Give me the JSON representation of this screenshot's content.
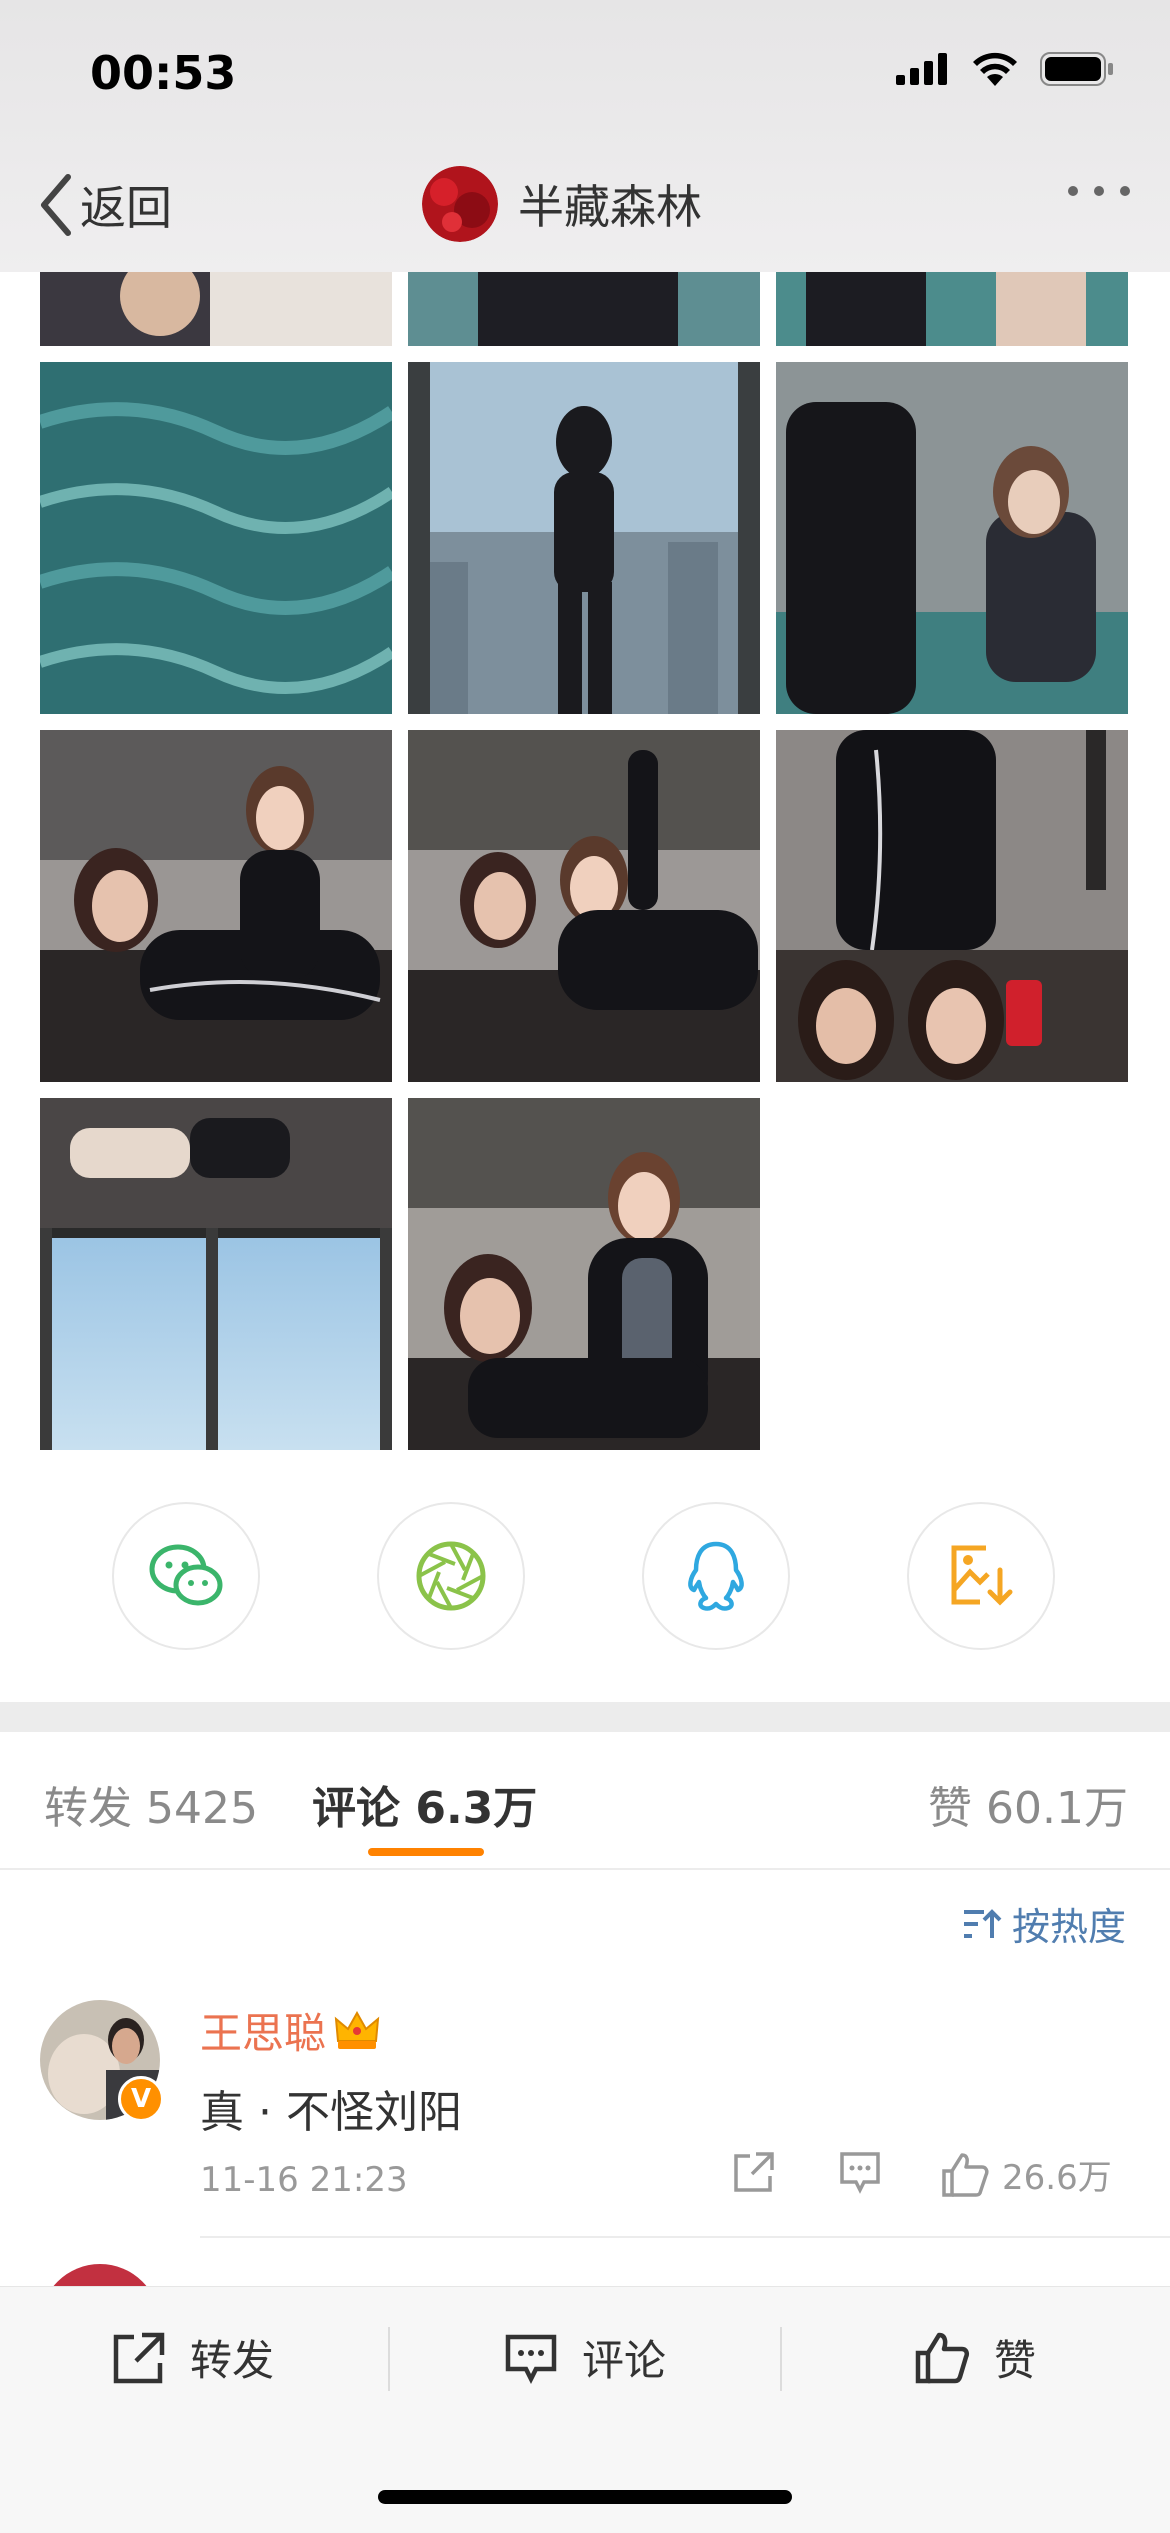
{
  "status": {
    "time": "00:53"
  },
  "nav": {
    "back_label": "返回",
    "title": "半藏森林"
  },
  "photos": [
    {
      "name": "photo-1"
    },
    {
      "name": "photo-2"
    },
    {
      "name": "photo-3"
    },
    {
      "name": "photo-4"
    },
    {
      "name": "photo-5"
    },
    {
      "name": "photo-6"
    },
    {
      "name": "photo-7"
    },
    {
      "name": "photo-8"
    },
    {
      "name": "photo-9"
    },
    {
      "name": "photo-10"
    },
    {
      "name": "photo-11"
    }
  ],
  "share": [
    "wechat-icon",
    "moments-icon",
    "qq-icon",
    "save-image-icon"
  ],
  "tabs": {
    "repost_label": "转发",
    "repost_count": "5425",
    "comment_label": "评论",
    "comment_count": "6.3万",
    "like_label": "赞",
    "like_count": "60.1万"
  },
  "sort": {
    "label": "按热度"
  },
  "comment": {
    "author": "王思聪",
    "text": "真 · 不怪刘阳",
    "time": "11-16 21:23",
    "likes": "26.6万",
    "verified_mark": "V"
  },
  "bottom": {
    "repost": "转发",
    "comment": "评论",
    "like": "赞"
  },
  "colors": {
    "accent": "#ff8200",
    "name": "#eb7350",
    "link": "#507daf"
  }
}
